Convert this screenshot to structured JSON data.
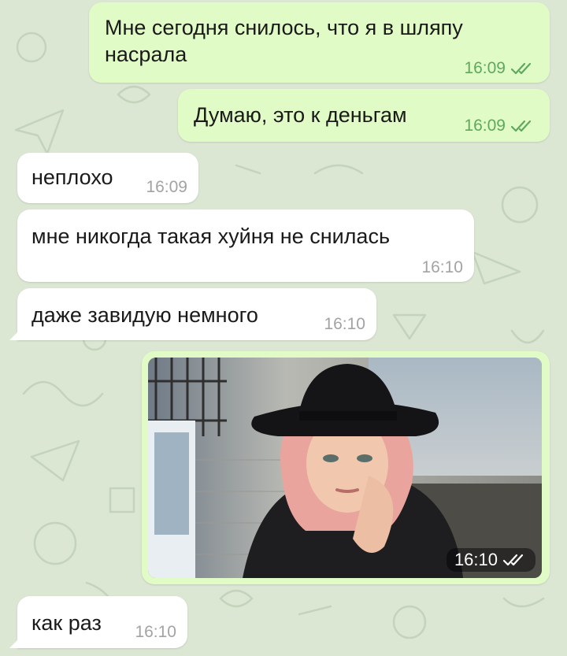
{
  "colors": {
    "background": "#dbe6d3",
    "outgoing_bubble": "#e1fbc6",
    "incoming_bubble": "#ffffff",
    "read_checks": "#5fa85f",
    "incoming_time": "#a3a3a3"
  },
  "messages": [
    {
      "direction": "outgoing",
      "text": "Мне сегодня снилось, что я в шляпу насрала",
      "time": "16:09",
      "status_icon": "double-check-icon"
    },
    {
      "direction": "outgoing",
      "text": "Думаю, это к деньгам",
      "time": "16:09",
      "status_icon": "double-check-icon"
    },
    {
      "direction": "incoming",
      "text": "неплохо",
      "time": "16:09"
    },
    {
      "direction": "incoming",
      "text": "мне никогда такая хуйня не снилась",
      "time": "16:10"
    },
    {
      "direction": "incoming",
      "text": "даже завидую немного",
      "time": "16:10"
    },
    {
      "direction": "outgoing",
      "type": "photo",
      "image": "selfie-woman-black-hat",
      "time": "16:10",
      "status_icon": "double-check-icon"
    },
    {
      "direction": "incoming",
      "text": "как раз",
      "time": "16:10"
    }
  ]
}
